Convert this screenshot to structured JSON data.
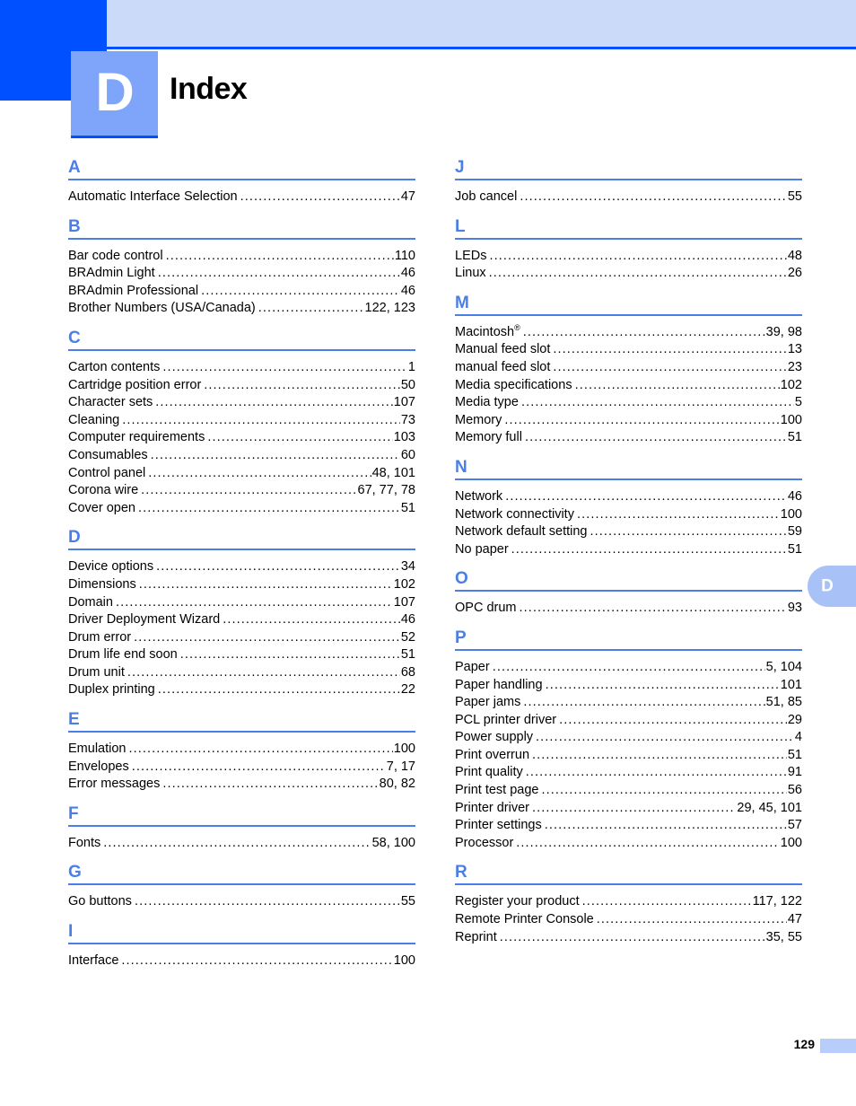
{
  "header": {
    "chapter_letter": "D",
    "title": "Index"
  },
  "thumb_tab": {
    "letter": "D"
  },
  "footer": {
    "page_number": "129"
  },
  "leader": "...................................................................................................................",
  "columns": [
    {
      "name": "left",
      "sections": [
        {
          "letter": "A",
          "entries": [
            {
              "label": "Automatic Interface Selection",
              "pages": "47"
            }
          ]
        },
        {
          "letter": "B",
          "entries": [
            {
              "label": "Bar code control",
              "pages": "110"
            },
            {
              "label": "BRAdmin Light",
              "pages": "46"
            },
            {
              "label": "BRAdmin Professional",
              "pages": "46"
            },
            {
              "label": "Brother Numbers (USA/Canada)",
              "pages": "122, 123"
            }
          ]
        },
        {
          "letter": "C",
          "entries": [
            {
              "label": "Carton contents",
              "pages": "1"
            },
            {
              "label": "Cartridge position error",
              "pages": "50"
            },
            {
              "label": "Character sets",
              "pages": "107"
            },
            {
              "label": "Cleaning",
              "pages": "73"
            },
            {
              "label": "Computer requirements",
              "pages": "103"
            },
            {
              "label": "Consumables",
              "pages": "60"
            },
            {
              "label": "Control panel",
              "pages": "48, 101"
            },
            {
              "label": "Corona wire",
              "pages": "67, 77, 78"
            },
            {
              "label": "Cover open",
              "pages": "51"
            }
          ]
        },
        {
          "letter": "D",
          "entries": [
            {
              "label": "Device options",
              "pages": "34"
            },
            {
              "label": "Dimensions",
              "pages": "102"
            },
            {
              "label": "Domain",
              "pages": "107"
            },
            {
              "label": "Driver Deployment Wizard",
              "pages": "46"
            },
            {
              "label": "Drum error",
              "pages": "52"
            },
            {
              "label": "Drum life end soon",
              "pages": "51"
            },
            {
              "label": "Drum unit",
              "pages": "68"
            },
            {
              "label": "Duplex printing",
              "pages": "22"
            }
          ]
        },
        {
          "letter": "E",
          "entries": [
            {
              "label": "Emulation",
              "pages": "100"
            },
            {
              "label": "Envelopes",
              "pages": "7, 17"
            },
            {
              "label": "Error messages",
              "pages": "80, 82"
            }
          ]
        },
        {
          "letter": "F",
          "entries": [
            {
              "label": "Fonts",
              "pages": "58, 100"
            }
          ]
        },
        {
          "letter": "G",
          "entries": [
            {
              "label": "Go buttons",
              "pages": "55"
            }
          ]
        },
        {
          "letter": "I",
          "entries": [
            {
              "label": "Interface",
              "pages": "100"
            }
          ]
        }
      ]
    },
    {
      "name": "right",
      "sections": [
        {
          "letter": "J",
          "entries": [
            {
              "label": "Job cancel",
              "pages": "55"
            }
          ]
        },
        {
          "letter": "L",
          "entries": [
            {
              "label": "LEDs",
              "pages": "48"
            },
            {
              "label": "Linux",
              "pages": "26"
            }
          ]
        },
        {
          "letter": "M",
          "entries": [
            {
              "label": "Macintosh",
              "superscript": "®",
              "pages": "39, 98"
            },
            {
              "label": "Manual feed slot",
              "pages": "13"
            },
            {
              "label": "manual feed slot",
              "pages": "23"
            },
            {
              "label": "Media specifications",
              "pages": "102"
            },
            {
              "label": "Media type",
              "pages": "5"
            },
            {
              "label": "Memory",
              "pages": "100"
            },
            {
              "label": "Memory full",
              "pages": "51"
            }
          ]
        },
        {
          "letter": "N",
          "entries": [
            {
              "label": "Network",
              "pages": "46"
            },
            {
              "label": "Network connectivity",
              "pages": "100"
            },
            {
              "label": "Network default setting",
              "pages": "59"
            },
            {
              "label": "No paper",
              "pages": "51"
            }
          ]
        },
        {
          "letter": "O",
          "entries": [
            {
              "label": "OPC drum",
              "pages": "93"
            }
          ]
        },
        {
          "letter": "P",
          "entries": [
            {
              "label": "Paper",
              "pages": "5, 104"
            },
            {
              "label": "Paper handling",
              "pages": "101"
            },
            {
              "label": "Paper jams",
              "pages": "51, 85"
            },
            {
              "label": "PCL printer driver",
              "pages": "29"
            },
            {
              "label": "Power supply",
              "pages": "4"
            },
            {
              "label": "Print overrun",
              "pages": "51"
            },
            {
              "label": "Print quality",
              "pages": "91"
            },
            {
              "label": "Print test page",
              "pages": "56"
            },
            {
              "label": "Printer driver",
              "pages": "29, 45, 101"
            },
            {
              "label": "Printer settings",
              "pages": "57"
            },
            {
              "label": "Processor",
              "pages": "100"
            }
          ]
        },
        {
          "letter": "R",
          "entries": [
            {
              "label": "Register your product",
              "pages": "117, 122"
            },
            {
              "label": "Remote Printer Console",
              "pages": "47"
            },
            {
              "label": "Reprint",
              "pages": "35, 55"
            }
          ]
        }
      ]
    }
  ]
}
